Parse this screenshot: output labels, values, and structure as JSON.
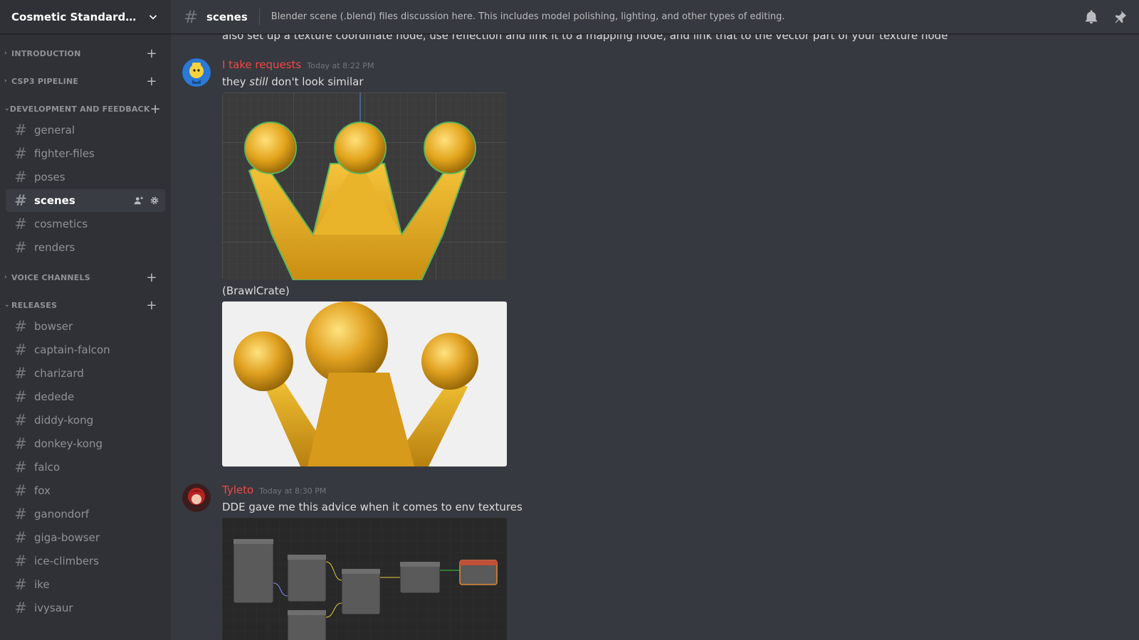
{
  "server": {
    "name": "Cosmetic Standardizatio..."
  },
  "categories": {
    "introduction": "INTRODUCTION",
    "csp3": "CSP3 PIPELINE",
    "dev": "DEVELOPMENT AND FEEDBACK",
    "voice": "VOICE CHANNELS",
    "releases": "RELEASES"
  },
  "dev_channels": [
    "general",
    "fighter-files",
    "poses",
    "scenes",
    "cosmetics",
    "renders"
  ],
  "release_channels": [
    "bowser",
    "captain-falcon",
    "charizard",
    "dedede",
    "diddy-kong",
    "donkey-kong",
    "falco",
    "fox",
    "ganondorf",
    "giga-bowser",
    "ice-climbers",
    "ike",
    "ivysaur"
  ],
  "channel": {
    "name": "scenes",
    "topic": "Blender scene (.blend) files discussion here. This includes model polishing, lighting, and other types of editing."
  },
  "partial_message": "also set up a texture coordinate node, use reflection and link it to a mapping node, and link that to the vector part of your texture node",
  "messages": [
    {
      "author": "I take requests",
      "time": "Today at 8:22 PM",
      "text_before": "they ",
      "text_em": "still",
      "text_after": " don't look similar",
      "caption": "(BrawlCrate)"
    },
    {
      "author": "Tyleto",
      "time": "Today at 8:30 PM",
      "text": "DDE gave me this advice when it comes to env textures"
    }
  ],
  "colors": {
    "sidebar": "#2f3136",
    "main": "#36393f",
    "username": "#f04747",
    "active_channel": "#393c43"
  },
  "icons": [
    "chevron-down-icon",
    "hash-icon",
    "plus-icon",
    "bell-icon",
    "pin-icon",
    "add-member-icon",
    "gear-icon"
  ]
}
